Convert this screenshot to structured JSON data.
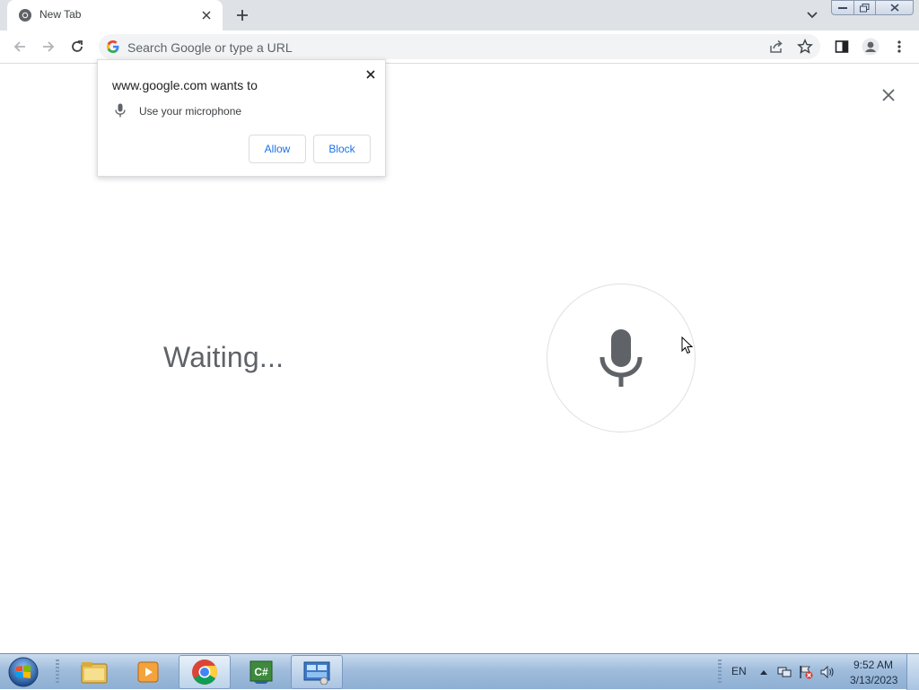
{
  "browser": {
    "tab": {
      "title": "New Tab"
    },
    "omnibox": {
      "placeholder": "Search Google or type a URL"
    }
  },
  "permission_popup": {
    "title": "www.google.com wants to",
    "permission": "Use your microphone",
    "allow_label": "Allow",
    "block_label": "Block"
  },
  "voice_search": {
    "status": "Waiting..."
  },
  "taskbar": {
    "language": "EN",
    "time": "9:52 AM",
    "date": "3/13/2023"
  },
  "colors": {
    "tabstrip_bg": "#dee1e6",
    "accent_blue": "#1a73e8",
    "mic_gray": "#5f6368",
    "taskbar_blue": "#9fbcdc"
  },
  "icons": [
    "chrome-favicon-icon",
    "close-icon",
    "plus-icon",
    "chevron-down-icon",
    "back-arrow-icon",
    "forward-arrow-icon",
    "reload-icon",
    "google-g-icon",
    "share-icon",
    "star-icon",
    "side-panel-icon",
    "profile-icon",
    "kebab-menu-icon",
    "microphone-icon",
    "mouse-cursor-icon",
    "windows-start-icon",
    "file-explorer-icon",
    "media-player-icon",
    "chrome-icon",
    "csharp-icon",
    "control-panel-icon",
    "network-icon",
    "speaker-icon"
  ]
}
